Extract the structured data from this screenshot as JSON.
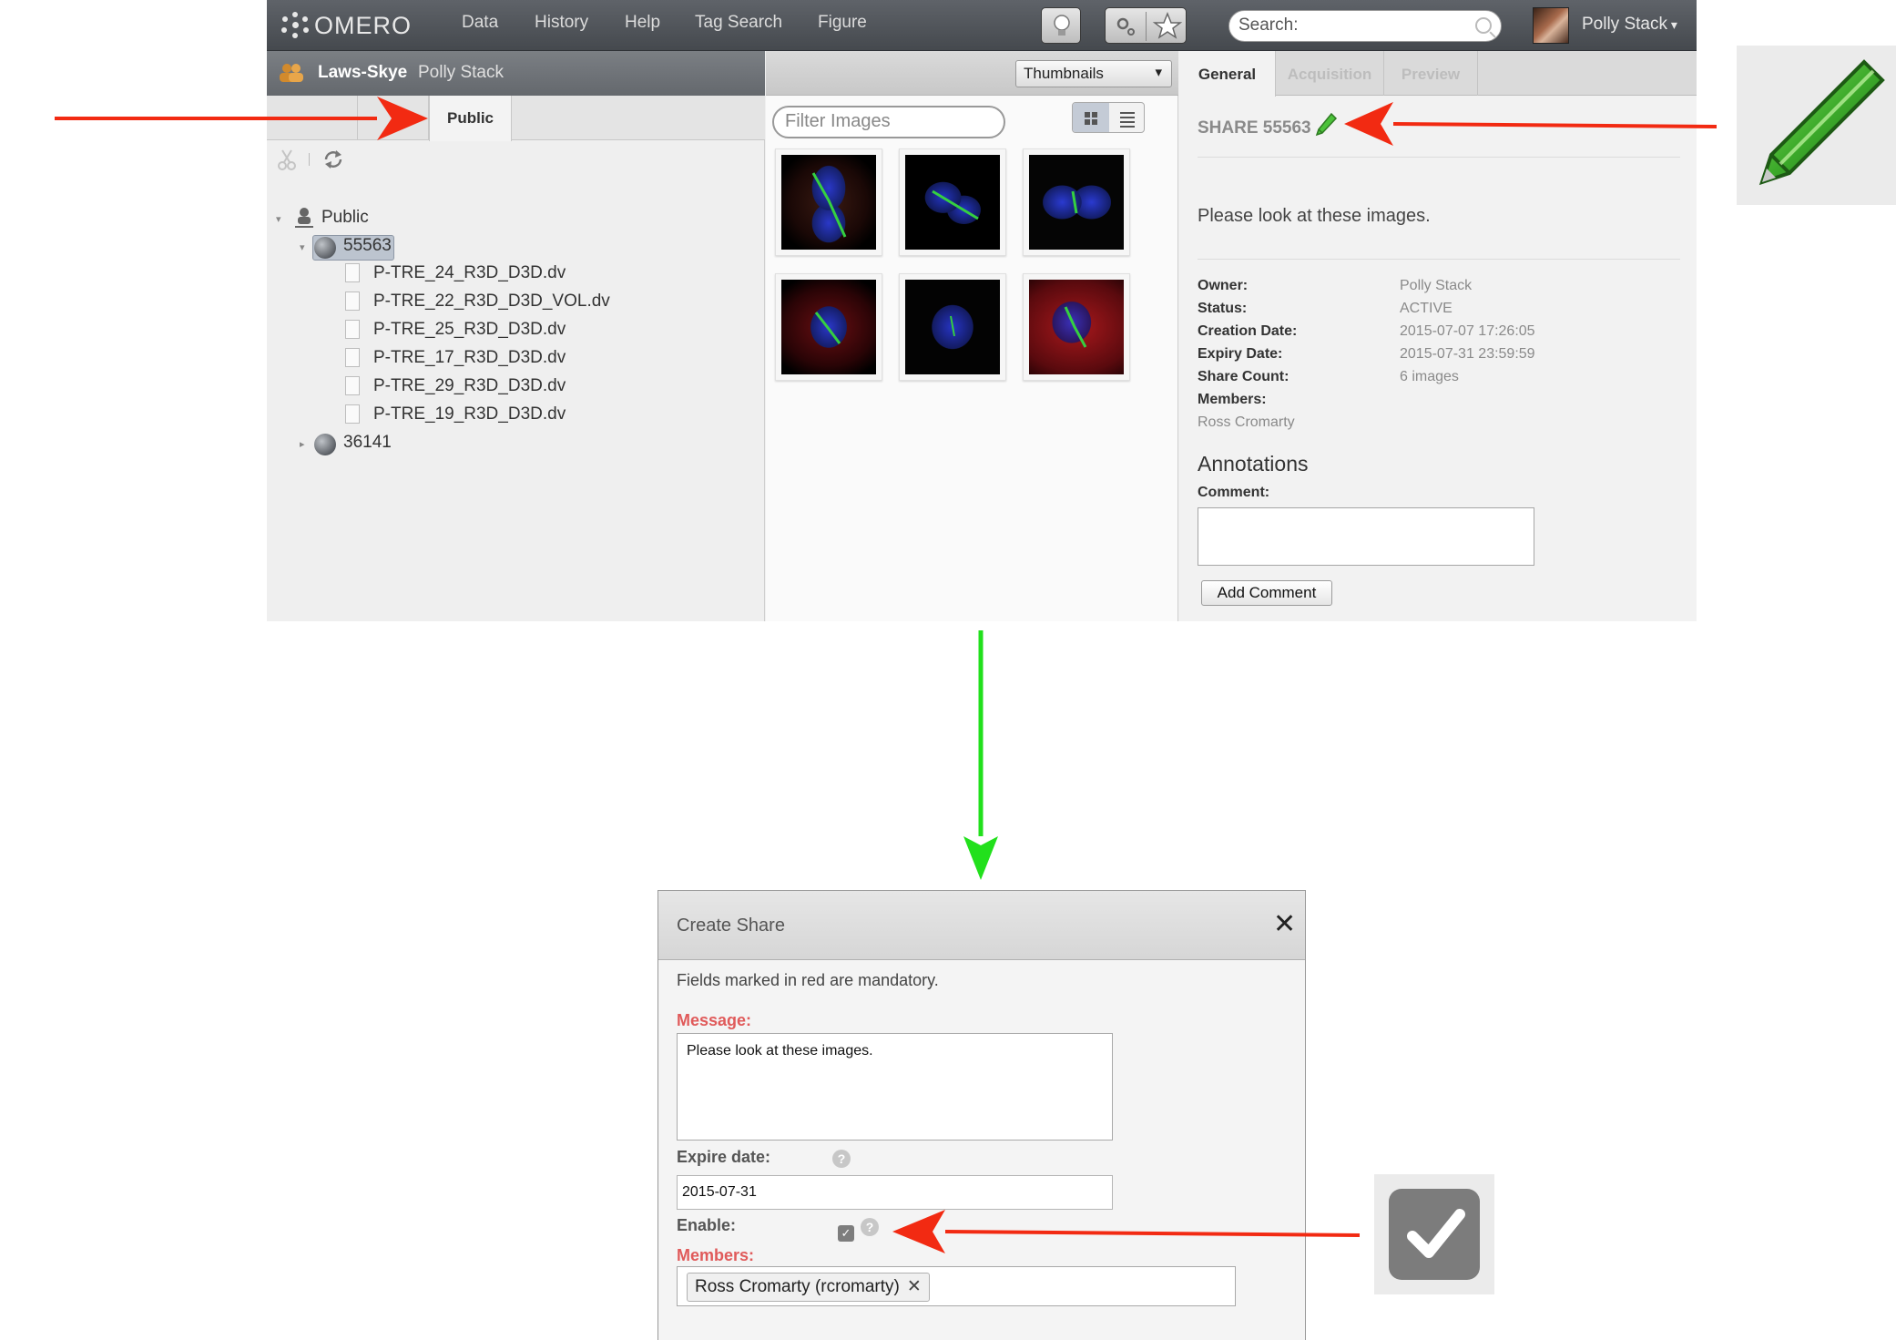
{
  "app": {
    "brand": "OMERO",
    "nav": [
      "Data",
      "History",
      "Help",
      "Tag Search",
      "Figure"
    ],
    "search_placeholder": "Search:",
    "user": "Polly Stack"
  },
  "left_panel": {
    "group_name": "Laws-Skye",
    "group_user": "Polly Stack",
    "tab_public": "Public",
    "tree": {
      "root": "Public",
      "share_selected": "55563",
      "images": [
        "P-TRE_24_R3D_D3D.dv",
        "P-TRE_22_R3D_D3D_VOL.dv",
        "P-TRE_25_R3D_D3D.dv",
        "P-TRE_17_R3D_D3D.dv",
        "P-TRE_29_R3D_D3D.dv",
        "P-TRE_19_R3D_D3D.dv"
      ],
      "share_other": "36141"
    }
  },
  "center_panel": {
    "view_select": "Thumbnails",
    "filter_placeholder": "Filter Images",
    "thumbnail_count": 6
  },
  "right_panel": {
    "tabs": [
      "General",
      "Acquisition",
      "Preview"
    ],
    "share_title": "SHARE 55563",
    "message": "Please look at these images.",
    "fields": [
      {
        "label": "Owner:",
        "value": "Polly Stack"
      },
      {
        "label": "Status:",
        "value": "ACTIVE"
      },
      {
        "label": "Creation Date:",
        "value": "2015-07-07 17:26:05"
      },
      {
        "label": "Expiry Date:",
        "value": "2015-07-31 23:59:59"
      },
      {
        "label": "Share Count:",
        "value": "6 images"
      },
      {
        "label": "Members:",
        "value": ""
      }
    ],
    "member_name": "Ross Cromarty",
    "annotations_heading": "Annotations",
    "comment_label": "Comment:",
    "add_comment_button": "Add Comment"
  },
  "dialog": {
    "title": "Create Share",
    "close_glyph": "✕",
    "note": "Fields marked in red are mandatory.",
    "message_label": "Message:",
    "message_value": "Please look at these images.",
    "expire_label": "Expire date:",
    "expire_value": "2015-07-31",
    "enable_label": "Enable:",
    "enable_checked": true,
    "members_label": "Members:",
    "member_chip": "Ross Cromarty (rcromarty)",
    "help_glyph": "?"
  },
  "colors": {
    "callout_arrow": "#f22a12",
    "flow_arrow": "#22e01c",
    "mandatory_label": "#e05a5a",
    "pencil": "#3caa2a"
  }
}
